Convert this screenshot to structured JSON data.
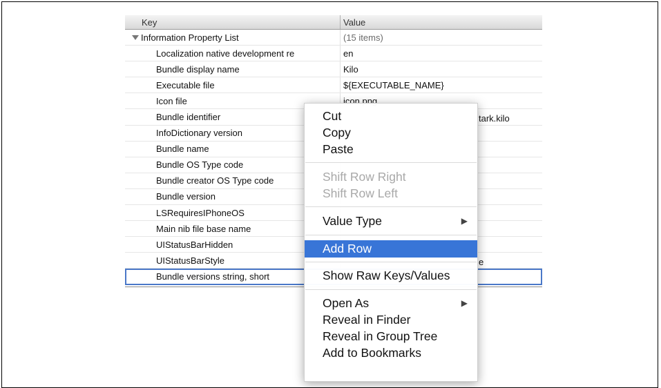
{
  "plist": {
    "header": {
      "key": "Key",
      "value": "Value"
    },
    "root": {
      "key": "Information Property List",
      "value": "(15 items)"
    },
    "rows": [
      {
        "key": "Localization native development re",
        "value": "en"
      },
      {
        "key": "Bundle display name",
        "value": "Kilo"
      },
      {
        "key": "Executable file",
        "value": "${EXECUTABLE_NAME}"
      },
      {
        "key": "Icon file",
        "value": "icon.png"
      },
      {
        "key": "Bundle identifier",
        "value": "tark.kilo"
      },
      {
        "key": "InfoDictionary version",
        "value": ""
      },
      {
        "key": "Bundle name",
        "value": ""
      },
      {
        "key": "Bundle OS Type code",
        "value": ""
      },
      {
        "key": "Bundle creator OS Type code",
        "value": ""
      },
      {
        "key": "Bundle version",
        "value": ""
      },
      {
        "key": "LSRequiresIPhoneOS",
        "value": ""
      },
      {
        "key": "Main nib file base name",
        "value": ""
      },
      {
        "key": "UIStatusBarHidden",
        "value": ""
      },
      {
        "key": "UIStatusBarStyle",
        "value": "e"
      },
      {
        "key": "Bundle versions string, short",
        "value": ""
      }
    ]
  },
  "context_menu": {
    "items": {
      "cut": "Cut",
      "copy": "Copy",
      "paste": "Paste",
      "shift_right": "Shift Row Right",
      "shift_left": "Shift Row Left",
      "value_type": "Value Type",
      "add_row": "Add Row",
      "show_raw": "Show Raw Keys/Values",
      "open_as": "Open As",
      "reveal_finder": "Reveal in Finder",
      "reveal_group": "Reveal in Group Tree",
      "add_bookmarks": "Add to Bookmarks"
    },
    "submenu_arrow": "▶",
    "highlight_color": "#3875d7"
  }
}
